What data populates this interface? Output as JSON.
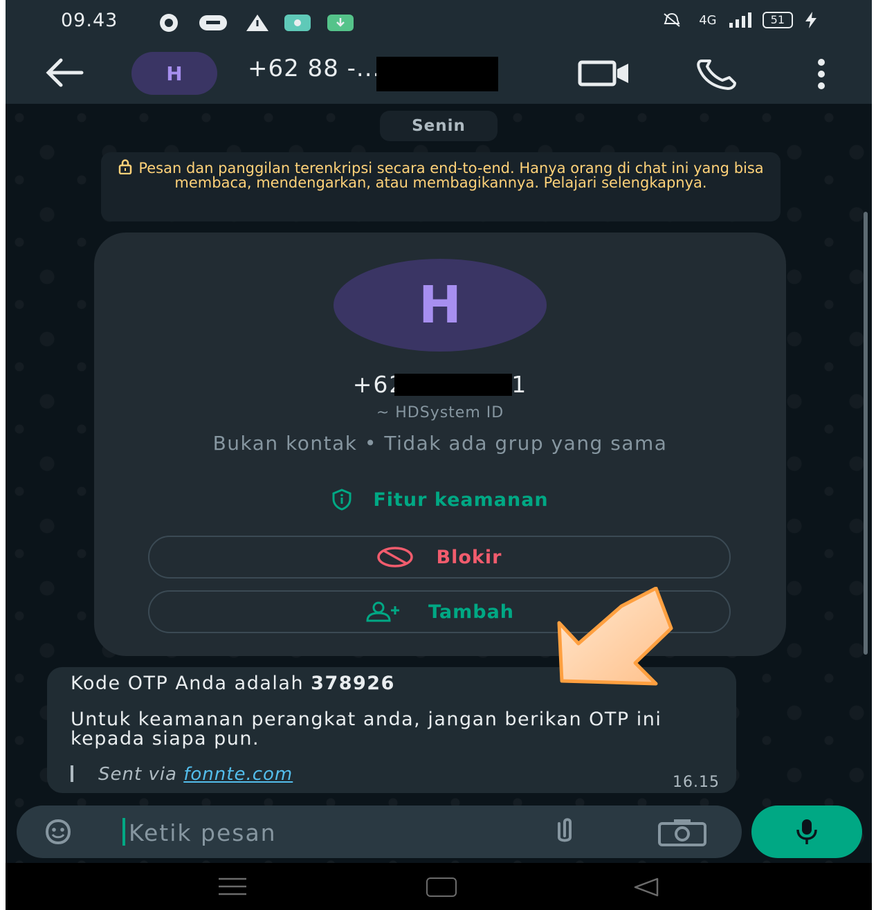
{
  "status_bar": {
    "time": "09.43",
    "network": "4G",
    "battery": "51"
  },
  "header": {
    "avatar_letter": "H",
    "title": "+62 88 -..."
  },
  "chat": {
    "date_chip": "Senin",
    "e2e_notice": "Pesan dan panggilan terenkripsi secara end-to-end. Hanya orang di chat ini yang bisa membaca, mendengarkan, atau membagikannya. Pelajari selengkapnya."
  },
  "contact_card": {
    "avatar_letter": "H",
    "phone": "+62 88 -5131",
    "name": "~ HDSystem ID",
    "info": "Bukan kontak • Tidak ada grup yang sama",
    "security_label": "Fitur keamanan",
    "block_label": "Blokir",
    "add_label": "Tambah"
  },
  "message": {
    "line1_prefix": "Kode OTP Anda adalah ",
    "otp_code": "378926",
    "line2": "Untuk keamanan perangkat anda, jangan berikan OTP ini kepada siapa pun.",
    "footer_prefix": "Sent via ",
    "footer_link": "fonnte.com",
    "time": "16.15"
  },
  "input": {
    "placeholder": "Ketik pesan"
  },
  "colors": {
    "accent_green": "#00a884",
    "danger_red": "#f15c6d",
    "notice_yellow": "#ffd279",
    "avatar_bg": "#3a3564",
    "avatar_fg": "#a78ff0",
    "annotation_orange": "#ffa040"
  },
  "icons": {
    "back": "arrow-left-icon",
    "video": "video-camera-icon",
    "call": "phone-icon",
    "more": "more-vertical-icon",
    "lock": "lock-icon",
    "shield": "shield-icon",
    "block": "block-icon",
    "add_person": "person-add-icon",
    "emoji": "sticker-icon",
    "attach": "paperclip-icon",
    "camera": "camera-icon",
    "mic": "microphone-icon"
  }
}
